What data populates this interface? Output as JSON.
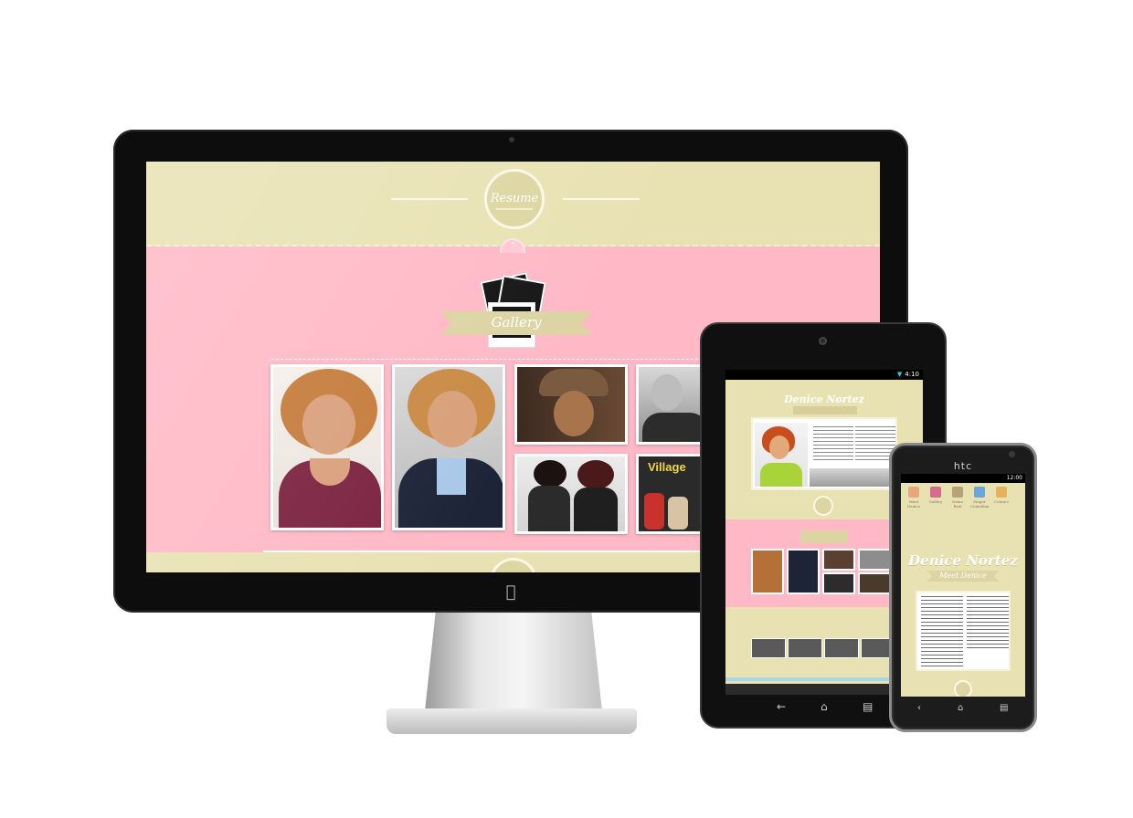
{
  "desktop": {
    "header_badge_label": "Resume",
    "section_title": "Gallery",
    "scroll_up_icon": "chevron-up-icon",
    "logo_icon": "apple-icon",
    "gallery_labels": [
      "Village"
    ]
  },
  "tablet": {
    "status_time": "4:10",
    "page_title": "Denice Nortez",
    "nav_keys": [
      "back-icon",
      "home-icon",
      "recent-apps-icon"
    ]
  },
  "phone": {
    "brand": "htc",
    "status_time": "12:00",
    "menu": [
      {
        "label": "Meet Denice",
        "icon_color": "#e9a87c"
      },
      {
        "label": "Gallery",
        "icon_color": "#d46e8e"
      },
      {
        "label": "Demo Reel",
        "icon_color": "#b7a27a"
      },
      {
        "label": "Singer Comedian",
        "icon_color": "#6fa6d8"
      },
      {
        "label": "Contact",
        "icon_color": "#e6b35c"
      }
    ],
    "page_title": "Denice Nortez",
    "page_subtitle": "Meet Denice",
    "nav_keys": [
      "back-icon",
      "home-icon",
      "recent-apps-icon"
    ]
  },
  "colors": {
    "cream": "#e8e2b3",
    "pink": "#ffb9c6",
    "bezel": "#0d0d0d"
  }
}
